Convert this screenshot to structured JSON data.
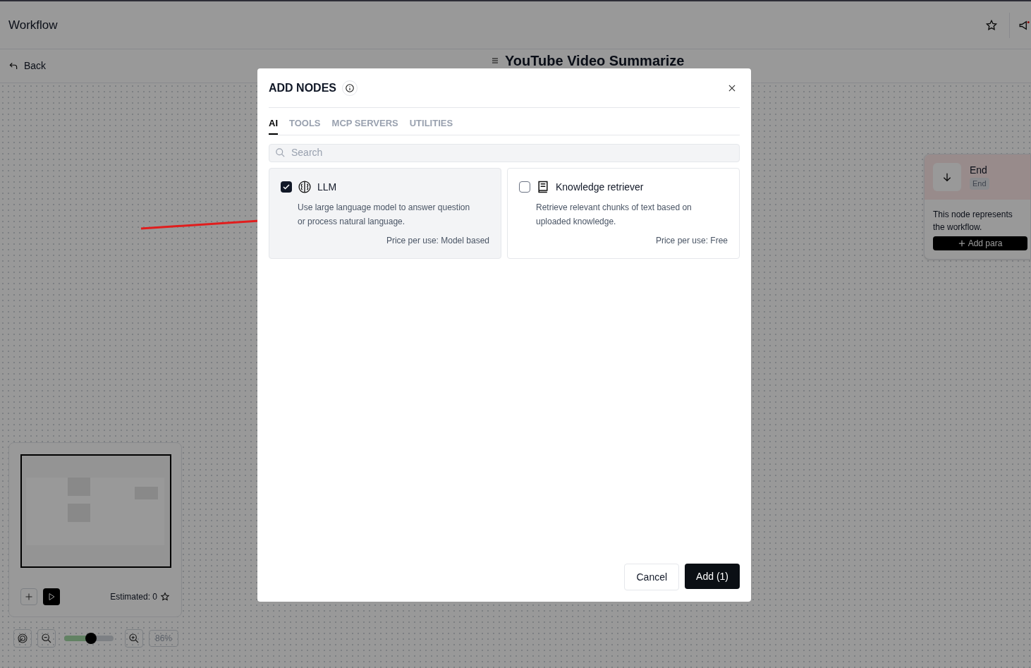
{
  "header": {
    "title": "Workflow"
  },
  "subheader": {
    "back": "Back",
    "workflow_title": "YouTube Video Summarize"
  },
  "end_node": {
    "title": "End",
    "tag": "End",
    "description": "This node represents the workflow.",
    "button": "Add para"
  },
  "minimap": {
    "estimated": "Estimated: 0"
  },
  "zoom": {
    "level": 0.54,
    "reading": "86%"
  },
  "modal": {
    "title": "ADD NODES",
    "tabs": [
      {
        "label": "AI",
        "selected": true
      },
      {
        "label": "TOOLS",
        "selected": false
      },
      {
        "label": "MCP SERVERS",
        "selected": false
      },
      {
        "label": "UTILITIES",
        "selected": false
      }
    ],
    "search": {
      "placeholder": "Search"
    },
    "nodes": [
      {
        "kind": "llm",
        "title": "LLM",
        "description": "Use large language model to answer question or process natural language.",
        "price": "Price per use: Model based",
        "checked": true
      },
      {
        "kind": "knowledge",
        "title": "Knowledge retriever",
        "description": "Retrieve relevant chunks of text based on uploaded knowledge.",
        "price": "Price per use: Free",
        "checked": false
      }
    ],
    "buttons": [
      {
        "kind": "secondary",
        "label": "Cancel"
      },
      {
        "kind": "primary",
        "label": "Add (1)"
      }
    ]
  }
}
